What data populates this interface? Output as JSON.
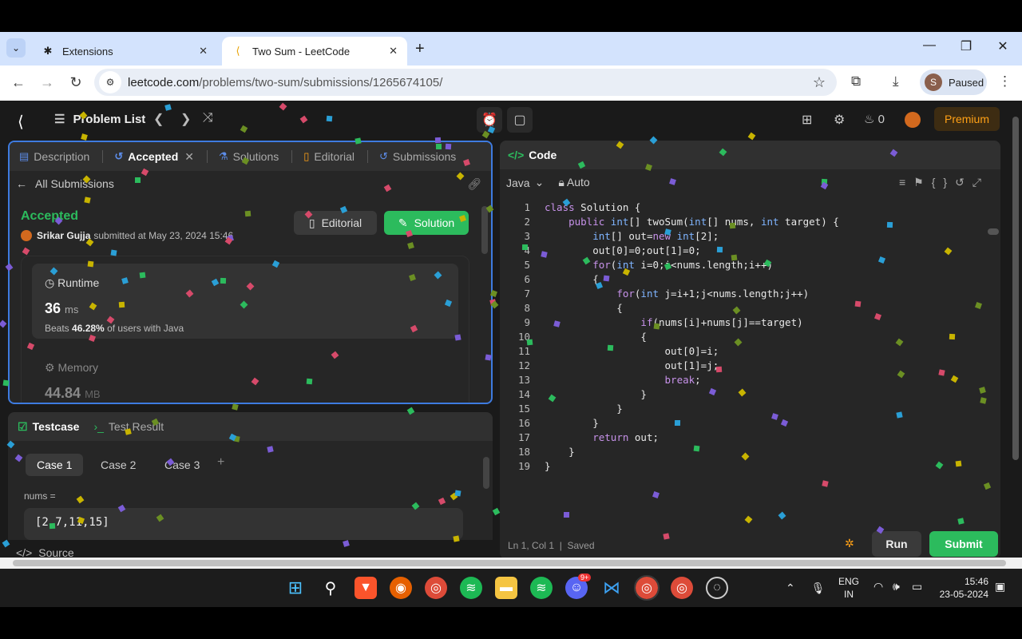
{
  "browser": {
    "tabs": [
      {
        "title": "Extensions",
        "icon": "puzzle-icon"
      },
      {
        "title": "Two Sum - LeetCode",
        "icon": "leetcode-icon"
      }
    ],
    "url_host": "leetcode.com",
    "url_path": "/problems/two-sum/submissions/1265674105/",
    "profile_initial": "S",
    "profile_status": "Paused"
  },
  "lc_nav": {
    "problem_list": "Problem List",
    "streak": "0",
    "premium": "Premium"
  },
  "left_tabs": [
    {
      "label": "Description"
    },
    {
      "label": "Accepted"
    },
    {
      "label": "Solutions"
    },
    {
      "label": "Editorial"
    },
    {
      "label": "Submissions"
    }
  ],
  "submission": {
    "all_submissions": "All Submissions",
    "status": "Accepted",
    "user": "Srikar Gujja",
    "submitted_text": "submitted at May 23, 2024 15:46",
    "editorial_btn": "Editorial",
    "solution_btn": "Solution",
    "runtime_label": "Runtime",
    "runtime_value": "36",
    "runtime_unit": "ms",
    "beats_prefix": "Beats",
    "beats_pct": "46.28%",
    "beats_suffix": "of users with Java",
    "memory_label": "Memory",
    "memory_value": "44.84",
    "memory_unit": "MB"
  },
  "testcase": {
    "tab_testcase": "Testcase",
    "tab_result": "Test Result",
    "cases": [
      "Case 1",
      "Case 2",
      "Case 3"
    ],
    "param_label": "nums =",
    "param_value": "[2,7,11,15]",
    "source_label": "Source"
  },
  "code_panel": {
    "title": "Code",
    "language": "Java",
    "mode": "Auto",
    "lines": [
      "class Solution {",
      "    public int[] twoSum(int[] nums, int target) {",
      "        int[] out=new int[2];",
      "        out[0]=0;out[1]=0;",
      "        for(int i=0;i<nums.length;i++)",
      "        {",
      "            for(int j=i+1;j<nums.length;j++)",
      "            {",
      "                if(nums[i]+nums[j]==target)",
      "                {",
      "                    out[0]=i;",
      "                    out[1]=j;",
      "                    break;",
      "                }",
      "            }",
      "        }",
      "        return out;",
      "    }",
      "}"
    ],
    "cursor": "Ln 1, Col 1",
    "saved": "Saved",
    "run": "Run",
    "submit": "Submit"
  },
  "taskbar": {
    "lang_top": "ENG",
    "lang_bottom": "IN",
    "time": "15:46",
    "date": "23-05-2024",
    "discord_badge": "9+"
  }
}
